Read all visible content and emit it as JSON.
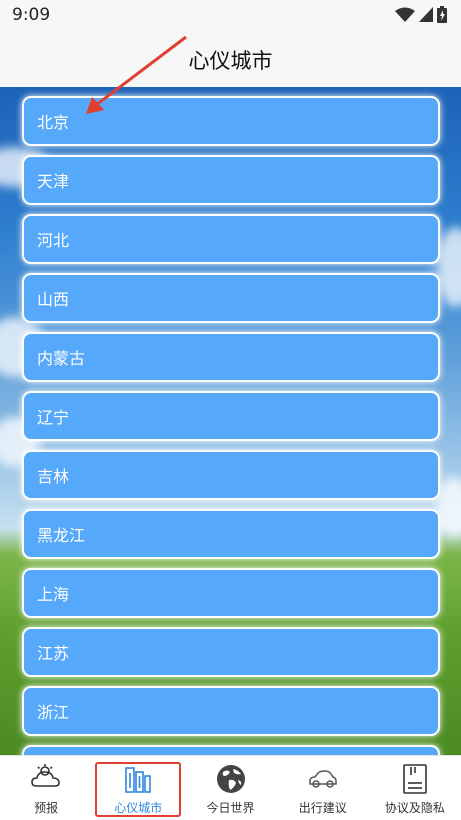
{
  "status": {
    "time": "9:09"
  },
  "header": {
    "title": "心仪城市"
  },
  "cities": [
    "北京",
    "天津",
    "河北",
    "山西",
    "内蒙古",
    "辽宁",
    "吉林",
    "黑龙江",
    "上海",
    "江苏",
    "浙江",
    ""
  ],
  "nav": [
    {
      "label": "预报",
      "icon": "weather-sun-cloud-icon"
    },
    {
      "label": "心仪城市",
      "icon": "city-buildings-icon",
      "active": true
    },
    {
      "label": "今日世界",
      "icon": "globe-icon"
    },
    {
      "label": "出行建议",
      "icon": "car-icon"
    },
    {
      "label": "协议及隐私",
      "icon": "document-icon"
    }
  ],
  "colors": {
    "item": "#56a8fa",
    "active": "#2e86de",
    "highlight": "#e04032"
  }
}
